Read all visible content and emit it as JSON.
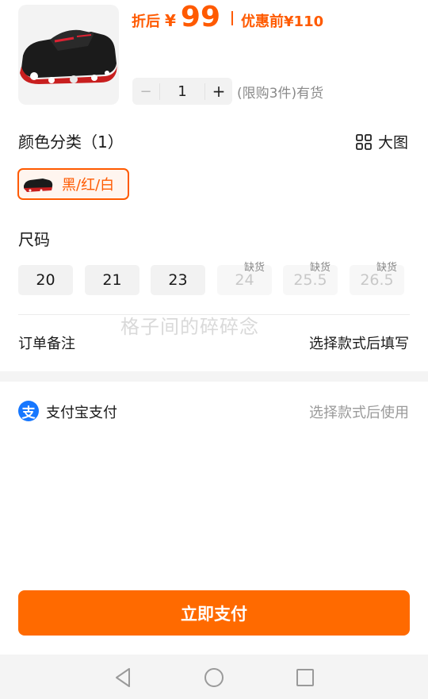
{
  "product": {
    "price_label": "折后",
    "currency": "¥",
    "price": "99",
    "orig_label": "优惠前",
    "orig_price": "¥110",
    "accent_color": "#ff5a00"
  },
  "quantity": {
    "minus": "−",
    "value": "1",
    "plus": "+",
    "stock_note": "(限购3件)有货"
  },
  "color_section": {
    "title": "颜色分类（1）",
    "big_image_label": "大图",
    "options": [
      {
        "label": "黑/红/白",
        "selected": true
      }
    ]
  },
  "size_section": {
    "title": "尺码",
    "sizes": [
      {
        "label": "20",
        "available": true,
        "tag": ""
      },
      {
        "label": "21",
        "available": true,
        "tag": ""
      },
      {
        "label": "23",
        "available": true,
        "tag": ""
      },
      {
        "label": "24",
        "available": false,
        "tag": "缺货"
      },
      {
        "label": "25.5",
        "available": false,
        "tag": "缺货"
      },
      {
        "label": "26.5",
        "available": false,
        "tag": "缺货"
      }
    ]
  },
  "watermark": "格子间的碎碎念",
  "remark": {
    "label": "订单备注",
    "value": "选择款式后填写"
  },
  "payment": {
    "method": "支付宝支付",
    "icon": "支",
    "hint": "选择款式后使用"
  },
  "cta": {
    "label": "立即支付",
    "color": "#ff6a00"
  },
  "nav": {
    "back": "back-icon",
    "home": "home-icon",
    "recent": "recent-apps-icon"
  }
}
